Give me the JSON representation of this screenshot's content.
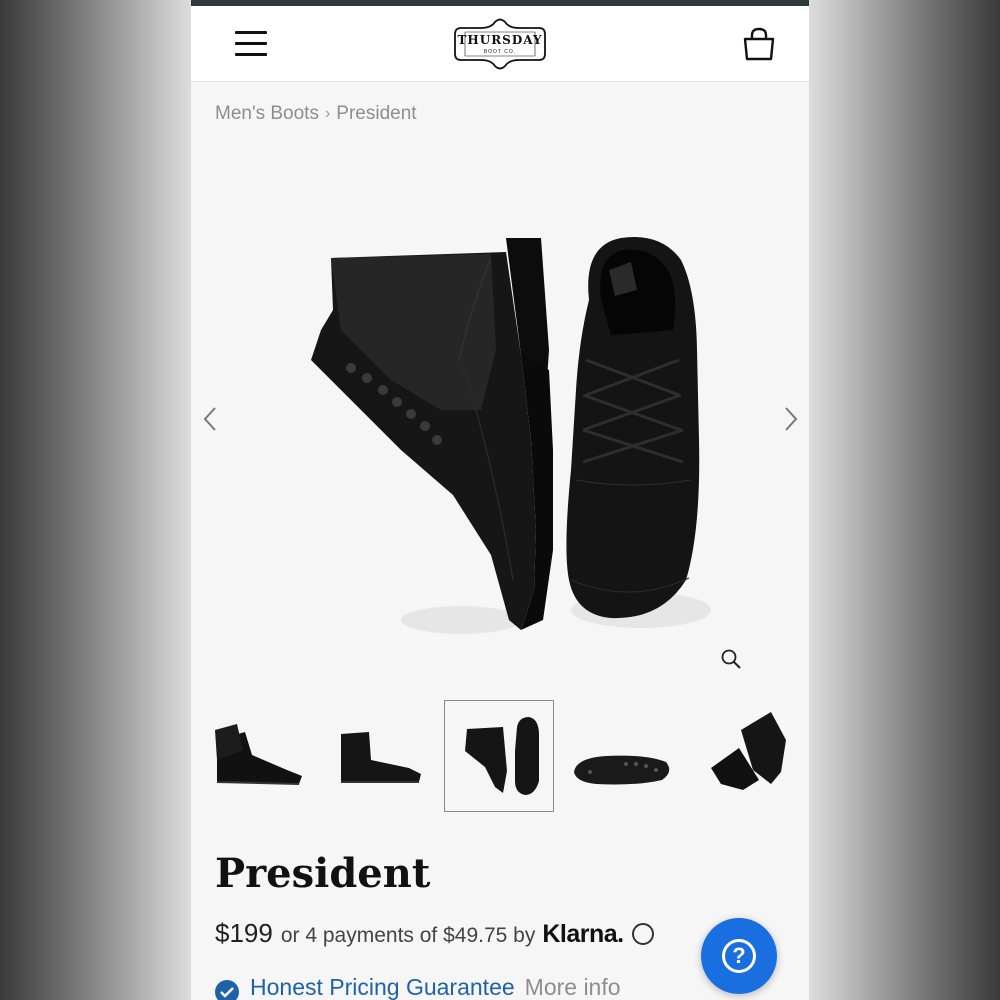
{
  "header": {
    "brand_name": "THURSDAY",
    "brand_sub": "BOOT CO.",
    "menu_icon": "hamburger-menu-icon",
    "cart_icon": "shopping-bag-icon"
  },
  "breadcrumb": {
    "items": [
      "Men's Boots",
      "President"
    ],
    "separator": "›"
  },
  "gallery": {
    "prev_icon": "chevron-left-icon",
    "next_icon": "chevron-right-icon",
    "zoom_icon": "magnifier-icon",
    "thumbnail_count": 5,
    "active_thumbnail": 3
  },
  "product": {
    "name": "President",
    "price": "$199",
    "installments": "or 4 payments of $49.75 by",
    "installment_provider": "Klarna.",
    "guarantee_label": "Honest Pricing Guarantee",
    "more_info_label": "More info"
  },
  "help": {
    "label": "?"
  },
  "colors": {
    "topbar": "#2d3b3d",
    "link_blue": "#1e62a9",
    "help_button": "#1a6fe0"
  }
}
